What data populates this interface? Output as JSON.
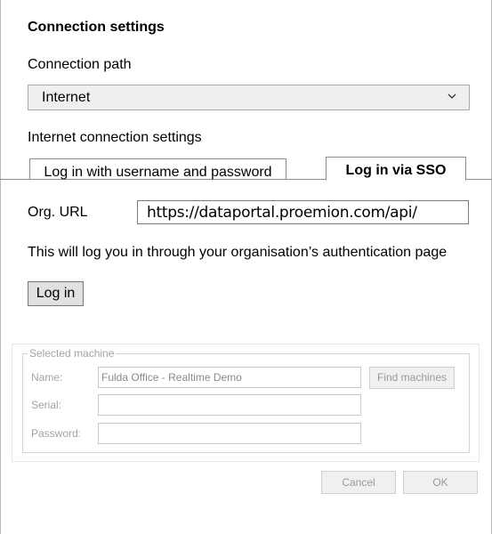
{
  "dialog": {
    "heading": "Connection settings",
    "connection_path_label": "Connection path",
    "connection_path_value": "Internet",
    "internet_settings_label": "Internet connection settings"
  },
  "tabs": [
    {
      "label": "Log in with username and password",
      "active": false
    },
    {
      "label": "Log in via SSO",
      "active": true
    }
  ],
  "sso": {
    "org_url_label": "Org. URL",
    "org_url_value": "https://dataportal.proemion.com/api/",
    "info_text": "This will log you in through your organisation’s authentication page",
    "login_label": "Log in"
  },
  "machine": {
    "group_title": "Selected machine",
    "name_label": "Name:",
    "name_value": "Fulda Office - Realtime Demo",
    "serial_label": "Serial:",
    "serial_value": "",
    "password_label": "Password:",
    "password_value": "",
    "find_label": "Find machines"
  },
  "footer": {
    "cancel_label": "Cancel",
    "ok_label": "OK"
  },
  "icons": {
    "dropdown": "chevron-down-icon"
  }
}
